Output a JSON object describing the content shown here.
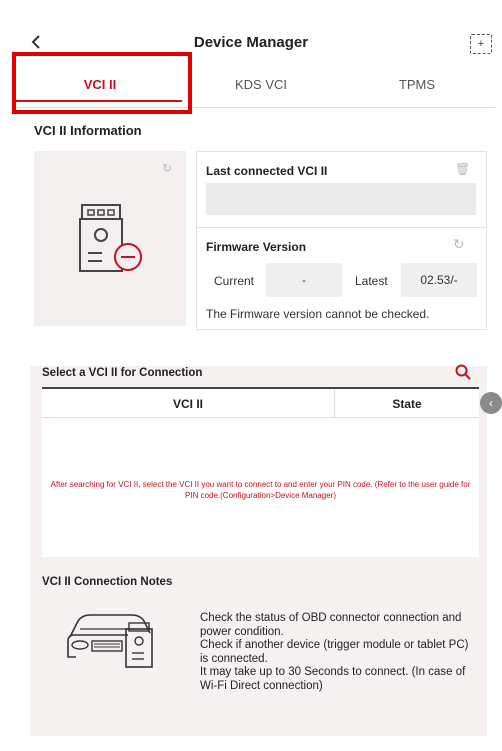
{
  "header": {
    "title": "Device Manager",
    "back_icon": "chevron-left-icon",
    "expand_icon": "expand-icon"
  },
  "tabs": [
    {
      "label": "VCI II",
      "active": true
    },
    {
      "label": "KDS VCI",
      "active": false
    },
    {
      "label": "TPMS",
      "active": false
    }
  ],
  "info": {
    "section_title": "VCI II Information",
    "last_connected_label": "Last connected VCI II",
    "last_connected_value": "",
    "firmware_label": "Firmware Version",
    "current_label": "Current",
    "current_value": "-",
    "latest_label": "Latest",
    "latest_value": "02.53/-",
    "firmware_message": "The Firmware version cannot be checked."
  },
  "connection": {
    "section_title": "Select a VCI II for Connection",
    "columns": [
      "VCI II",
      "State"
    ],
    "empty_message": "After searching for VCI II, select the VCI II you want to connect to and enter your PIN code. (Refer to the user guide for PIN code.(Configuration>Device Manager)"
  },
  "notes": {
    "section_title": "VCI II Connection Notes",
    "lines": [
      "Check the status of OBD connector connection and power condition.",
      "Check if another device (trigger module or tablet PC) is connected.",
      "It may take up to 30 Seconds to connect. (In case of Wi-Fi Direct connection)"
    ]
  },
  "colors": {
    "accent": "#c2131e",
    "highlight": "#e00000",
    "panel_bg": "#f3efef"
  }
}
